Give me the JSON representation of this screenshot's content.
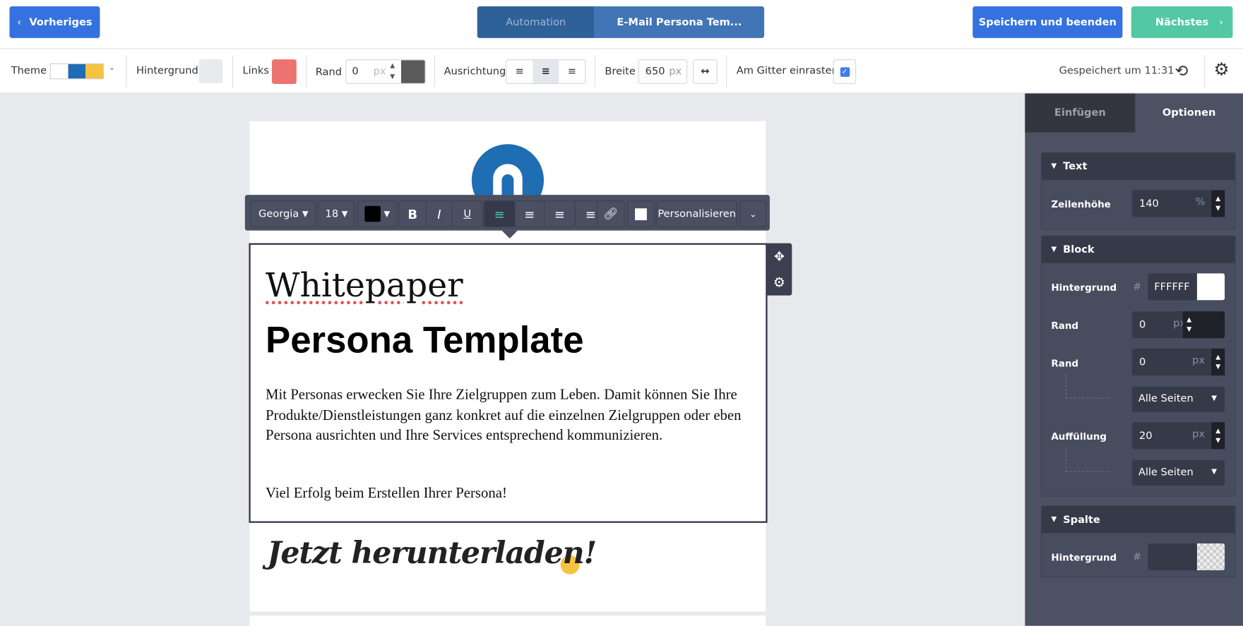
{
  "header": {
    "prev_label": "Vorheriges",
    "prev_icon": "chevron-left-icon",
    "breadcrumb": [
      "Automation",
      "E-Mail Persona Tem..."
    ],
    "save_label": "Speichern und beenden",
    "next_label": "Nächstes",
    "next_icon": "chevron-right-icon"
  },
  "toolbar": {
    "theme_label": "Theme",
    "theme_colors": [
      "#ffffff",
      "#1f6db3",
      "#f5c242"
    ],
    "background_label": "Hintergrund",
    "background_color": "#e9eaed",
    "links_label": "Links",
    "links_color": "#ec7370",
    "border_label": "Rand",
    "border_value": "0",
    "border_unit": "px",
    "border_color": "#5a5a5a",
    "align_label": "Ausrichtung",
    "width_label": "Breite",
    "width_value": "650",
    "width_unit": "px",
    "snap_label": "Am Gitter einrasten",
    "snap_checked": true,
    "saved_text": "Gespeichert um 11:31"
  },
  "text_toolbar": {
    "font": "Georgia",
    "size": "18",
    "color": "#000000",
    "personalize_label": "Personalisieren"
  },
  "email": {
    "title_line1": "Whitepaper",
    "title_line2": "Persona Template",
    "paragraph": "Mit Personas erwecken Sie Ihre Zielgruppen zum Leben. Damit können Sie Ihre Produkte/Dienstleistungen ganz konkret auf die einzelnen Zielgruppen oder eben Persona ausrichten und Ihre Services entsprechend kommunizieren.",
    "closing": "Viel Erfolg beim Erstellen Ihrer Persona!",
    "cta": "Jetzt herunterladen!"
  },
  "sidebar": {
    "tabs": [
      "Einfügen",
      "Optionen"
    ],
    "active_tab": "Optionen",
    "text_panel": {
      "title": "Text",
      "line_height_label": "Zeilenhöhe",
      "line_height_value": "140",
      "line_height_unit": "%"
    },
    "block_panel": {
      "title": "Block",
      "bg_label": "Hintergrund",
      "bg_hash": "#",
      "bg_value": "FFFFFF",
      "border1_label": "Rand",
      "border1_value": "0",
      "border1_unit": "px",
      "border2_label": "Rand",
      "border2_value": "0",
      "border2_unit": "px",
      "border2_sides": "Alle Seiten",
      "padding_label": "Auffüllung",
      "padding_value": "20",
      "padding_unit": "px",
      "padding_sides": "Alle Seiten"
    },
    "column_panel": {
      "title": "Spalte",
      "bg_label": "Hintergrund",
      "bg_hash": "#"
    }
  }
}
